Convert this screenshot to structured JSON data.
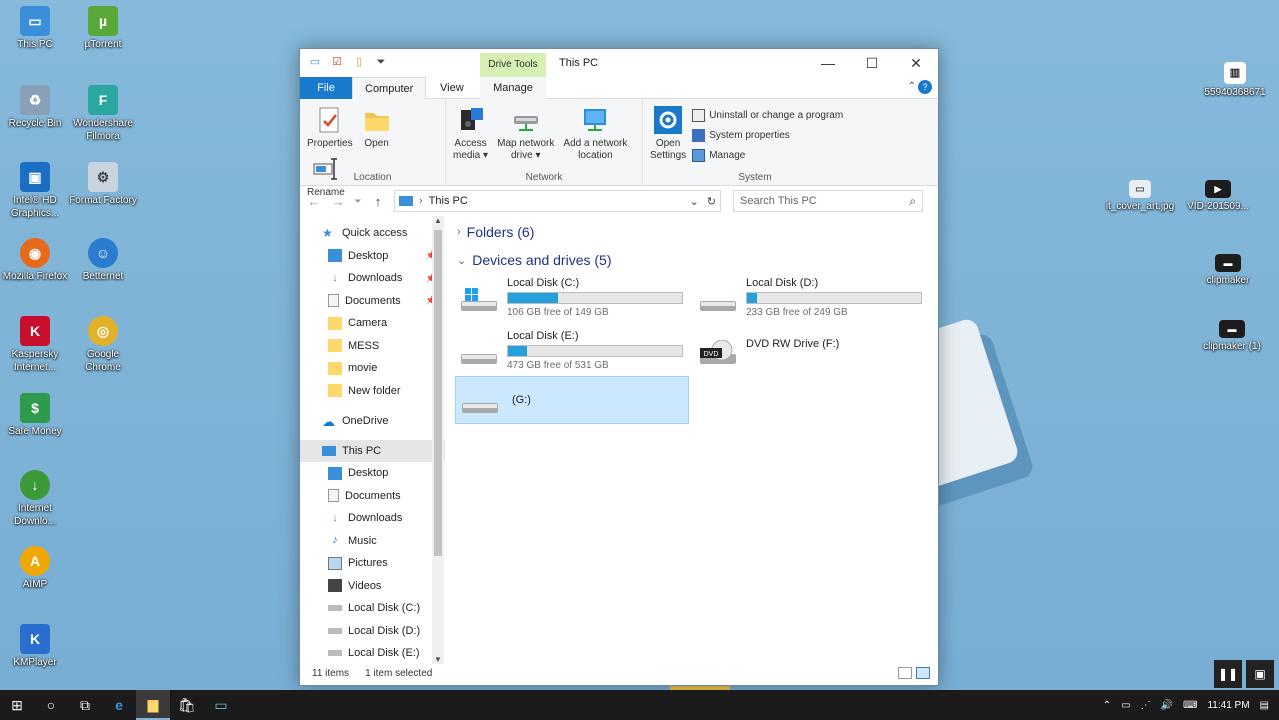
{
  "desktop": {
    "icons_left": [
      {
        "label": "This PC",
        "icon": "this-pc-icon",
        "color": "#3a8fd8"
      },
      {
        "label": "µTorrent",
        "icon": "utorrent-icon",
        "color": "#5aa83a"
      },
      {
        "label": "Recycle Bin",
        "icon": "recycle-bin-icon",
        "color": "#8aa0b8"
      },
      {
        "label": "Wondershare Filmora",
        "icon": "filmora-icon",
        "color": "#2aa7a0"
      },
      {
        "label": "Intel® HD Graphics...",
        "icon": "intel-graphics-icon",
        "color": "#1b6fc2"
      },
      {
        "label": "Format Factory",
        "icon": "format-factory-icon",
        "color": "#c8d4e0"
      },
      {
        "label": "Mozilla Firefox",
        "icon": "firefox-icon",
        "color": "#e66a1c"
      },
      {
        "label": "Betternet",
        "icon": "betternet-icon",
        "color": "#2b7bd0"
      },
      {
        "label": "Kaspersky Internet...",
        "icon": "kaspersky-icon",
        "color": "#c8102e"
      },
      {
        "label": "Google Chrome",
        "icon": "chrome-icon",
        "color": "#e2b12a"
      },
      {
        "label": "Safe Money",
        "icon": "safe-money-icon",
        "color": "#2e9a4c"
      },
      {
        "label": "Internet Downlo...",
        "icon": "idm-icon",
        "color": "#3a9a3a"
      },
      {
        "label": "AIMP",
        "icon": "aimp-icon",
        "color": "#f0a800"
      },
      {
        "label": "KMPlayer",
        "icon": "kmplayer-icon",
        "color": "#2a6fd0"
      }
    ],
    "icons_right": [
      {
        "label": "55940368671",
        "icon": "barcode-file-icon"
      },
      {
        "label": "it_cover_art.jpg",
        "icon": "image-file-icon"
      },
      {
        "label": "VID-201509...",
        "icon": "video-file-icon"
      },
      {
        "label": "clipmaker",
        "icon": "clipmaker-file-icon"
      },
      {
        "label": "clipmaker (1)",
        "icon": "clipmaker-file-icon"
      }
    ]
  },
  "window": {
    "title": "This PC",
    "contextual_tab": "Drive Tools",
    "tabs": {
      "file": "File",
      "computer": "Computer",
      "view": "View",
      "manage": "Manage"
    },
    "ribbon": {
      "location": {
        "label": "Location",
        "buttons": [
          {
            "label": "Properties",
            "icon": "properties-icon"
          },
          {
            "label": "Open",
            "icon": "open-folder-icon"
          },
          {
            "label": "Rename",
            "icon": "rename-icon"
          }
        ]
      },
      "network": {
        "label": "Network",
        "buttons": [
          {
            "label": "Access\nmedia ▾",
            "icon": "access-media-icon"
          },
          {
            "label": "Map network\ndrive ▾",
            "icon": "map-network-drive-icon"
          },
          {
            "label": "Add a network\nlocation",
            "icon": "add-network-location-icon"
          }
        ]
      },
      "system": {
        "label": "System",
        "open_settings": "Open\nSettings",
        "items": [
          "Uninstall or change a program",
          "System properties",
          "Manage"
        ]
      }
    },
    "address": {
      "path": "This PC",
      "search_placeholder": "Search This PC"
    },
    "nav": [
      {
        "label": "Quick access",
        "icon": "star-icon",
        "indent": 0,
        "pinned": false
      },
      {
        "label": "Desktop",
        "icon": "desktop-folder-icon",
        "indent": 1,
        "pinned": true
      },
      {
        "label": "Downloads",
        "icon": "downloads-icon",
        "indent": 1,
        "pinned": true
      },
      {
        "label": "Documents",
        "icon": "documents-icon",
        "indent": 1,
        "pinned": true
      },
      {
        "label": "Camera",
        "icon": "folder-icon",
        "indent": 1,
        "pinned": false
      },
      {
        "label": "MESS",
        "icon": "folder-icon",
        "indent": 1,
        "pinned": false
      },
      {
        "label": "movie",
        "icon": "folder-icon",
        "indent": 1,
        "pinned": false
      },
      {
        "label": "New folder",
        "icon": "folder-icon",
        "indent": 1,
        "pinned": false
      },
      {
        "label": "OneDrive",
        "icon": "onedrive-icon",
        "indent": 0,
        "pinned": false
      },
      {
        "label": "This PC",
        "icon": "this-pc-icon",
        "indent": 0,
        "pinned": false,
        "selected": true
      },
      {
        "label": "Desktop",
        "icon": "desktop-folder-icon",
        "indent": 1,
        "pinned": false
      },
      {
        "label": "Documents",
        "icon": "documents-icon",
        "indent": 1,
        "pinned": false
      },
      {
        "label": "Downloads",
        "icon": "downloads-icon",
        "indent": 1,
        "pinned": false
      },
      {
        "label": "Music",
        "icon": "music-icon",
        "indent": 1,
        "pinned": false
      },
      {
        "label": "Pictures",
        "icon": "pictures-icon",
        "indent": 1,
        "pinned": false
      },
      {
        "label": "Videos",
        "icon": "videos-icon",
        "indent": 1,
        "pinned": false
      },
      {
        "label": "Local Disk (C:)",
        "icon": "drive-icon",
        "indent": 1,
        "pinned": false
      },
      {
        "label": "Local Disk (D:)",
        "icon": "drive-icon",
        "indent": 1,
        "pinned": false
      },
      {
        "label": "Local Disk (E:)",
        "icon": "drive-icon",
        "indent": 1,
        "pinned": false
      }
    ],
    "sections": {
      "folders": "Folders (6)",
      "devices": "Devices and drives (5)"
    },
    "drives": [
      {
        "name": "Local Disk (C:)",
        "free": "106 GB free of 149 GB",
        "used_fraction": 0.29,
        "icon": "windows-drive-icon"
      },
      {
        "name": "Local Disk (D:)",
        "free": "233 GB free of 249 GB",
        "used_fraction": 0.06,
        "icon": "drive-icon"
      },
      {
        "name": "Local Disk (E:)",
        "free": "473 GB free of 531 GB",
        "used_fraction": 0.11,
        "icon": "drive-icon"
      },
      {
        "name": "DVD RW Drive (F:)",
        "icon": "dvd-drive-icon"
      },
      {
        "name": "(G:)",
        "icon": "drive-icon",
        "selected": true
      }
    ],
    "status": {
      "items": "11 items",
      "selected": "1 item selected"
    }
  },
  "taskbar": {
    "time": "11:41 PM",
    "buttons": [
      "start-icon",
      "search-circle-icon",
      "task-view-icon",
      "edge-icon",
      "file-explorer-icon",
      "store-icon",
      "app-icon"
    ]
  },
  "colors": {
    "accent": "#1979ca",
    "drive_fill": "#26a0da",
    "selection": "#cce8ff",
    "contextual": "#d6f0b4"
  }
}
